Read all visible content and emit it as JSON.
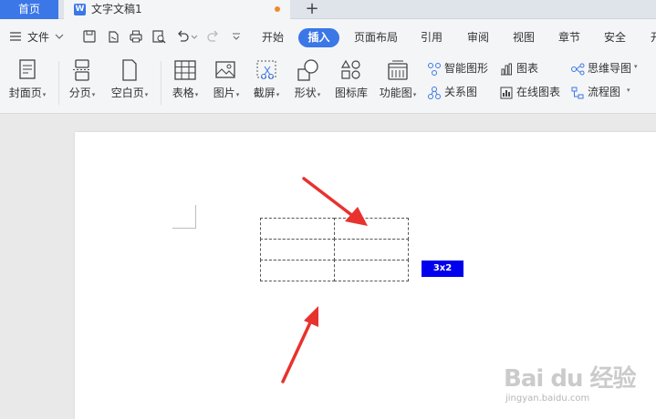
{
  "tabs": {
    "home": "首页",
    "doc_icon": "W",
    "doc_title": "文字文稿1",
    "new_tab": "+"
  },
  "menu": {
    "file": "文件",
    "items": [
      "开始",
      "插入",
      "页面布局",
      "引用",
      "审阅",
      "视图",
      "章节",
      "安全",
      "开"
    ]
  },
  "ribbon": {
    "cover": "封面页",
    "page_break": "分页",
    "blank_page": "空白页",
    "table": "表格",
    "picture": "图片",
    "screenshot": "截屏",
    "shapes": "形状",
    "icon_lib": "图标库",
    "func_chart": "功能图",
    "smart_art": "智能图形",
    "chart": "图表",
    "relation": "关系图",
    "online_chart": "在线图表",
    "mindmap": "思维导图",
    "flowchart": "流程图"
  },
  "document": {
    "table_size_badge": "3x2"
  },
  "watermark": {
    "main": "Bai du 经验",
    "sub": "jingyan.baidu.com"
  },
  "colors": {
    "accent": "#3b77e6",
    "badge": "#0000ee",
    "arrow": "#e8322e"
  }
}
